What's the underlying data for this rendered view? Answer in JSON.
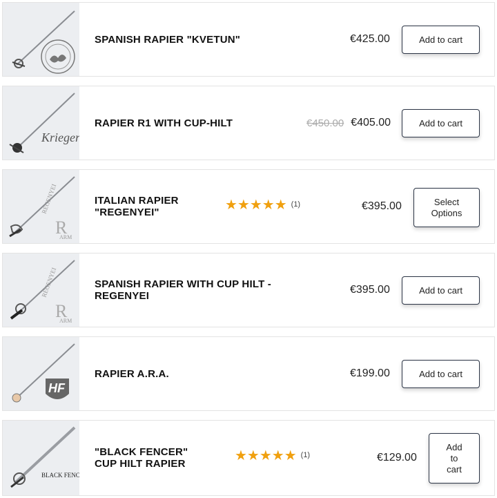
{
  "products": [
    {
      "name": "SPANISH RAPIER \"KVETUN\"",
      "price": "€425.00",
      "button": "Add to cart",
      "logo": "round-seal-logo"
    },
    {
      "name": "RAPIER R1 WITH CUP-HILT",
      "old_price": "€450.00",
      "price": "€405.00",
      "button": "Add to cart",
      "logo": "Krieger"
    },
    {
      "name": "ITALIAN RAPIER\n\"REGENYEI\"",
      "rating": 5,
      "rating_count": "(1)",
      "price": "€395.00",
      "button": "Select\nOptions",
      "logo": "REGENYEI ARMORY"
    },
    {
      "name": "SPANISH RAPIER WITH CUP HILT -\nREGENYEI",
      "price": "€395.00",
      "button": "Add to cart",
      "logo": "REGENYEI ARMORY"
    },
    {
      "name": "RAPIER A.R.A.",
      "price": "€199.00",
      "button": "Add to cart",
      "logo": "HF shield logo"
    },
    {
      "name": "\"BLACK FENCER\"\nCUP HILT RAPIER",
      "rating": 5,
      "rating_count": "(1)",
      "price": "€129.00",
      "button": "Add\nto\ncart",
      "logo": "BLACK FENCER"
    }
  ],
  "stars": "★★★★★",
  "colors": {
    "star": "#f0a00f",
    "button_border": "#2b3445",
    "thumb_bg": "#eceef1"
  }
}
